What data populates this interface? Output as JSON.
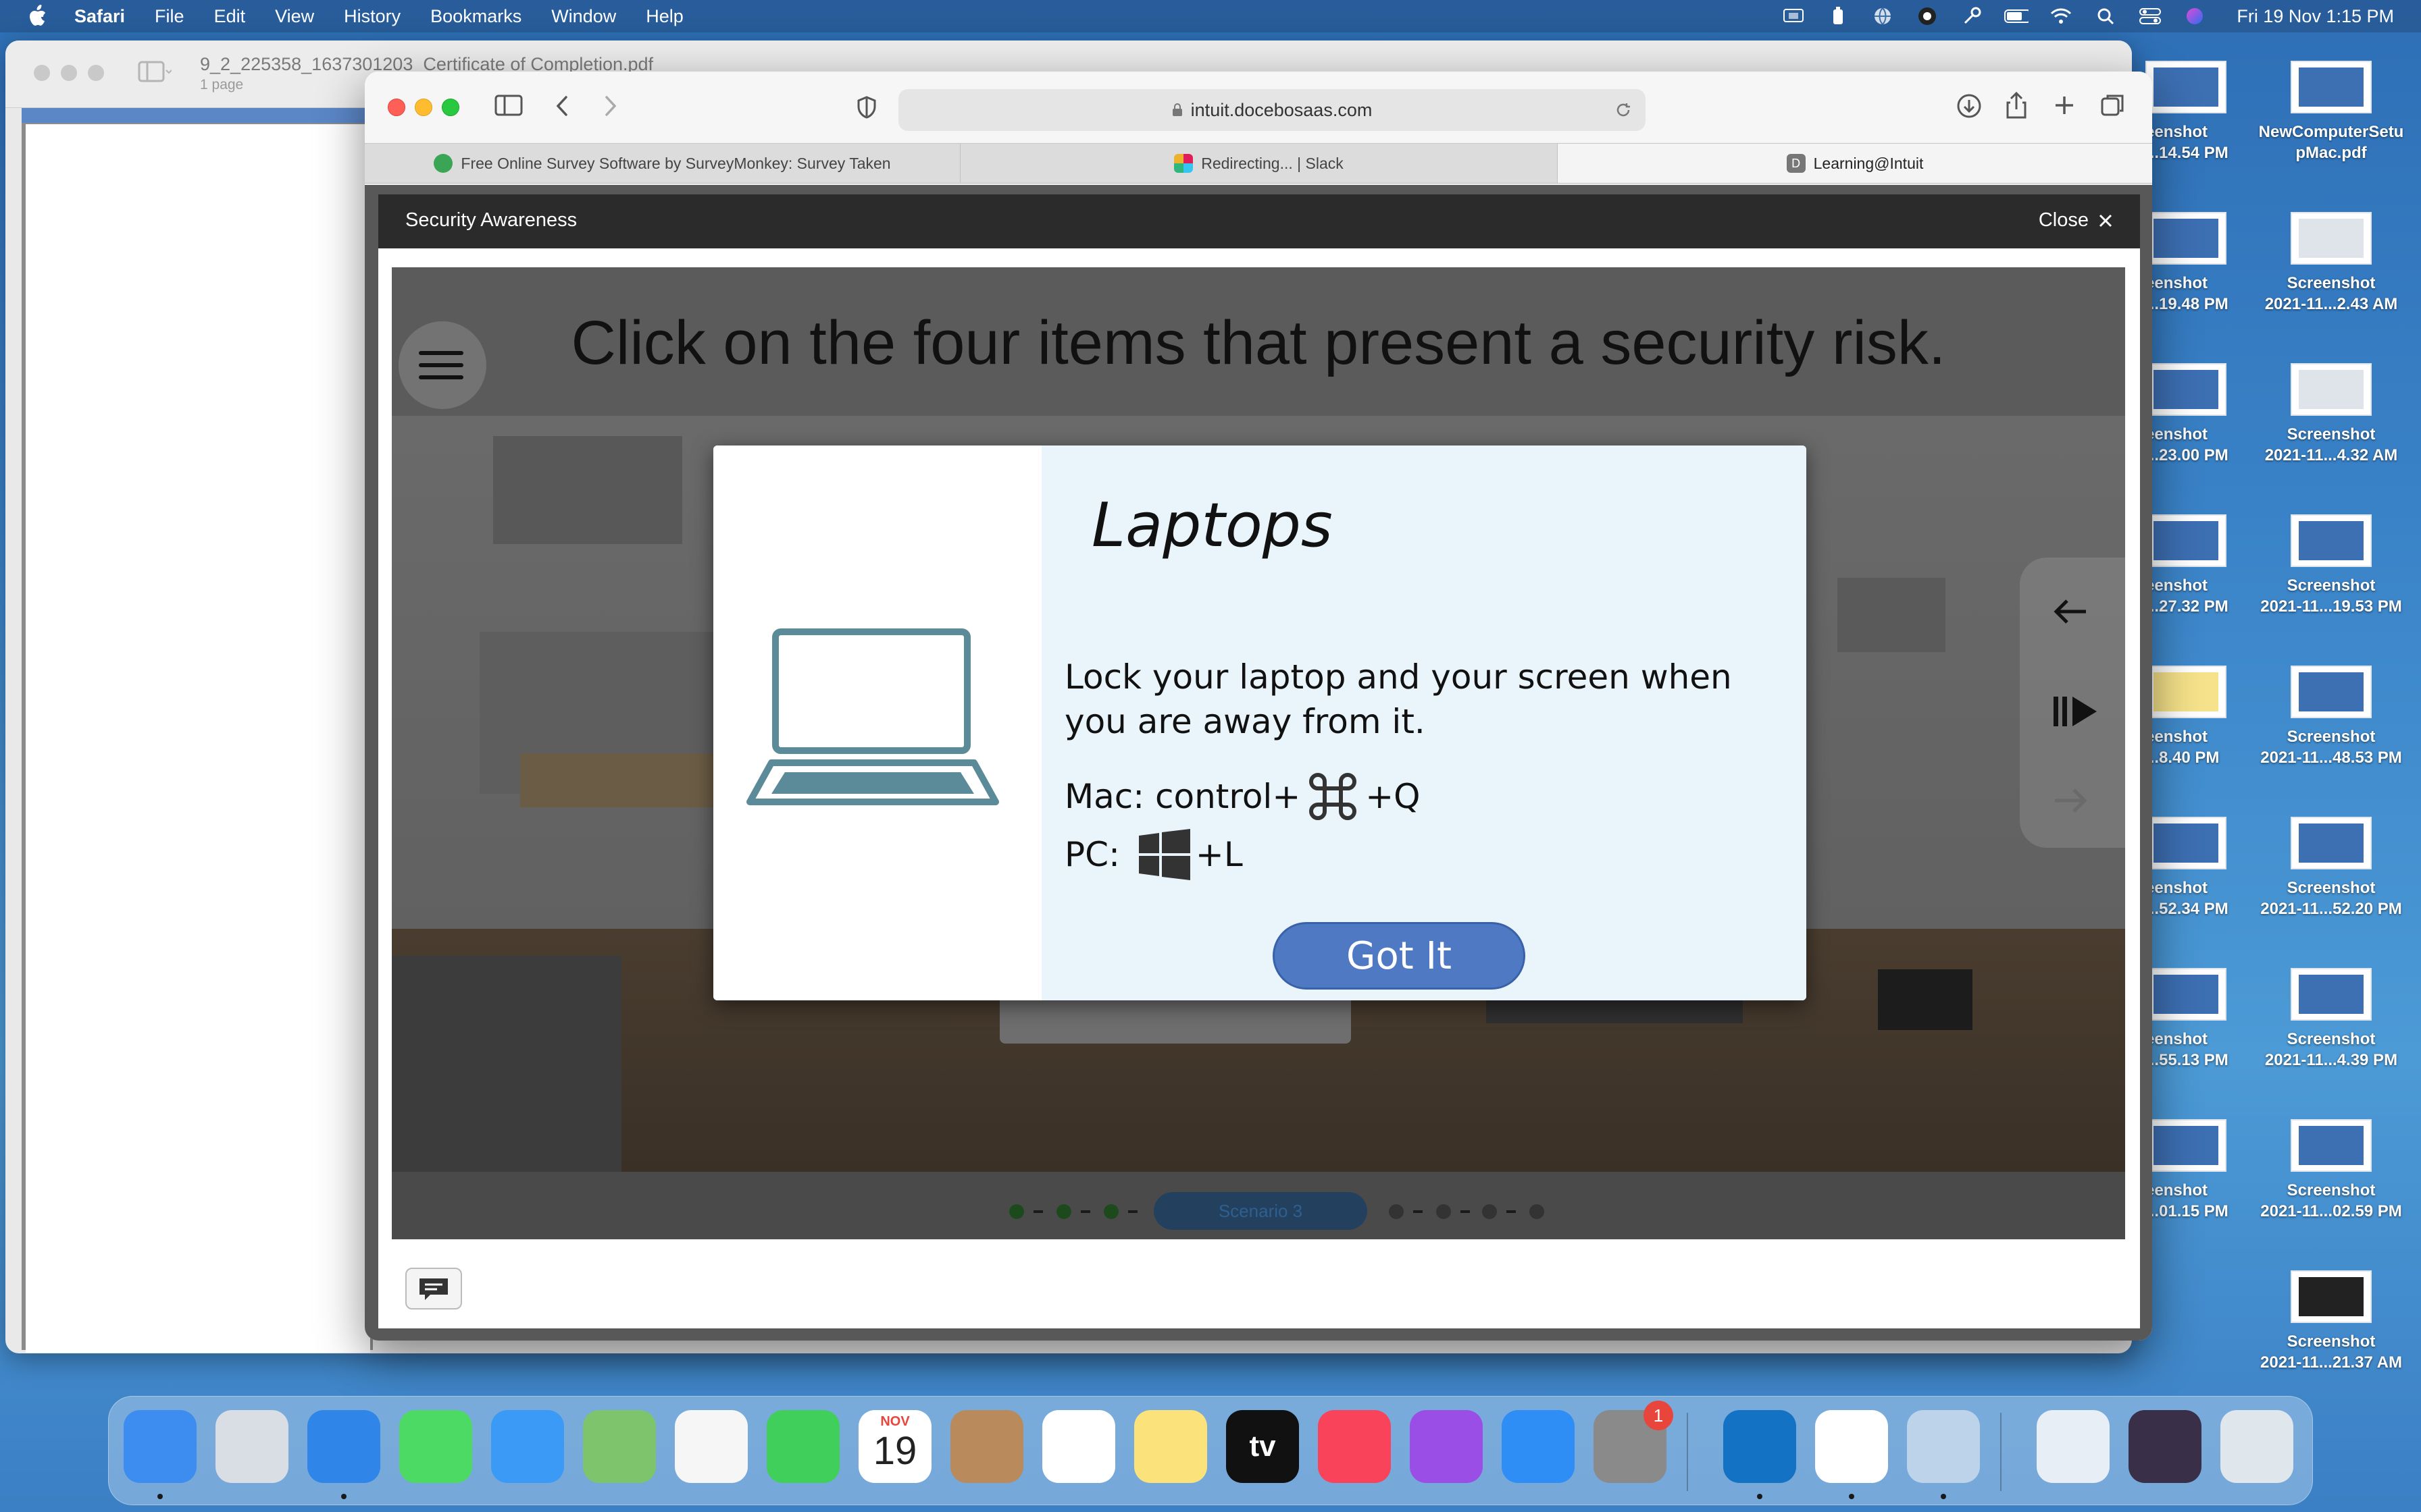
{
  "menubar": {
    "app_name": "Safari",
    "items": [
      "File",
      "Edit",
      "View",
      "History",
      "Bookmarks",
      "Window",
      "Help"
    ],
    "clock": "Fri 19 Nov  1:15 PM",
    "status_icons": [
      "screen-mirroring-icon",
      "battery-widget-icon",
      "globe-icon",
      "vpn-icon",
      "key-icon",
      "battery-icon",
      "wifi-icon",
      "spotlight-search-icon",
      "control-center-icon",
      "siri-icon"
    ]
  },
  "preview_window": {
    "title": "9_2_225358_1637301203_Certificate of Completion.pdf",
    "subtitle": "1 page"
  },
  "safari": {
    "url": "intuit.docebosaas.com",
    "tabs": [
      {
        "label": "Free Online Survey Software by SurveyMonkey: Survey Taken",
        "favicon": "surveymonkey-icon"
      },
      {
        "label": "Redirecting... | Slack",
        "favicon": "slack-icon"
      },
      {
        "label": "Learning@Intuit",
        "favicon": "docebo-icon"
      }
    ]
  },
  "player": {
    "title": "Security Awareness",
    "close_label": "Close",
    "heading": "Click on the four items that present a security risk.",
    "scenario_label": "Scenario 3",
    "modal": {
      "title": "Laptops",
      "body": "Lock your laptop and your screen when you are away from it.",
      "mac_prefix": "Mac: control+",
      "mac_suffix": "+Q",
      "pc_prefix": "PC:",
      "pc_suffix": "+L",
      "button": "Got It"
    }
  },
  "desktop_icons": [
    {
      "line1": "eenshot",
      "line2": "...14.54 PM",
      "thumb": "blue"
    },
    {
      "line1": "NewComputerSetu",
      "line2": "pMac.pdf",
      "thumb": "blue"
    },
    {
      "line1": "eenshot",
      "line2": "...19.48 PM",
      "thumb": "blue"
    },
    {
      "line1": "Screenshot",
      "line2": "2021-11...2.43 AM",
      "thumb": "light"
    },
    {
      "line1": "eenshot",
      "line2": "...23.00 PM",
      "thumb": "blue"
    },
    {
      "line1": "Screenshot",
      "line2": "2021-11...4.32 AM",
      "thumb": "light"
    },
    {
      "line1": "eenshot",
      "line2": "...27.32 PM",
      "thumb": "blue"
    },
    {
      "line1": "Screenshot",
      "line2": "2021-11...19.53 PM",
      "thumb": "blue"
    },
    {
      "line1": "eenshot",
      "line2": "...8.40 PM",
      "thumb": "yellow"
    },
    {
      "line1": "Screenshot",
      "line2": "2021-11...48.53 PM",
      "thumb": "blue"
    },
    {
      "line1": "eenshot",
      "line2": "...52.34 PM",
      "thumb": "blue"
    },
    {
      "line1": "Screenshot",
      "line2": "2021-11...52.20 PM",
      "thumb": "blue"
    },
    {
      "line1": "eenshot",
      "line2": "...55.13 PM",
      "thumb": "blue"
    },
    {
      "line1": "Screenshot",
      "line2": "2021-11...4.39 PM",
      "thumb": "blue"
    },
    {
      "line1": "eenshot",
      "line2": "...01.15 PM",
      "thumb": "blue"
    },
    {
      "line1": "Screenshot",
      "line2": "2021-11...02.59 PM",
      "thumb": "blue"
    },
    {
      "line1": "Screenshot",
      "line2": "2021-11...21.37 AM",
      "thumb": "dark"
    }
  ],
  "dock": {
    "apps": [
      {
        "name": "finder-icon",
        "color": "#3d8df0"
      },
      {
        "name": "launchpad-icon",
        "color": "#d9dde4"
      },
      {
        "name": "safari-icon",
        "color": "#2f86e8"
      },
      {
        "name": "messages-icon",
        "color": "#4cd964"
      },
      {
        "name": "mail-icon",
        "color": "#3b9af5"
      },
      {
        "name": "maps-icon",
        "color": "#7ec46d"
      },
      {
        "name": "photos-icon",
        "color": "#f6f6f6"
      },
      {
        "name": "facetime-icon",
        "color": "#3fcf5a"
      },
      {
        "name": "calendar-icon",
        "color": "#ffffff"
      },
      {
        "name": "contacts-icon",
        "color": "#b98b5c"
      },
      {
        "name": "reminders-icon",
        "color": "#ffffff"
      },
      {
        "name": "notes-icon",
        "color": "#fbe27a"
      },
      {
        "name": "apple-tv-icon",
        "color": "#111111"
      },
      {
        "name": "music-icon",
        "color": "#f8435b"
      },
      {
        "name": "podcasts-icon",
        "color": "#9b4ee6"
      },
      {
        "name": "app-store-icon",
        "color": "#2e8ef5"
      },
      {
        "name": "system-preferences-icon",
        "color": "#8a8a8a"
      },
      {
        "name": "outlook-icon",
        "color": "#1372c4"
      },
      {
        "name": "slack-icon",
        "color": "#ffffff"
      },
      {
        "name": "preview-icon",
        "color": "#bcd3ea"
      },
      {
        "name": "document-icon",
        "color": "#e8eef6"
      },
      {
        "name": "screenshot-stack-icon",
        "color": "#3a2f48"
      },
      {
        "name": "trash-icon",
        "color": "#dfe6ec"
      }
    ],
    "calendar_month": "NOV",
    "calendar_day": "19",
    "apple_tv_label": "tv",
    "notification_badge": "1"
  }
}
